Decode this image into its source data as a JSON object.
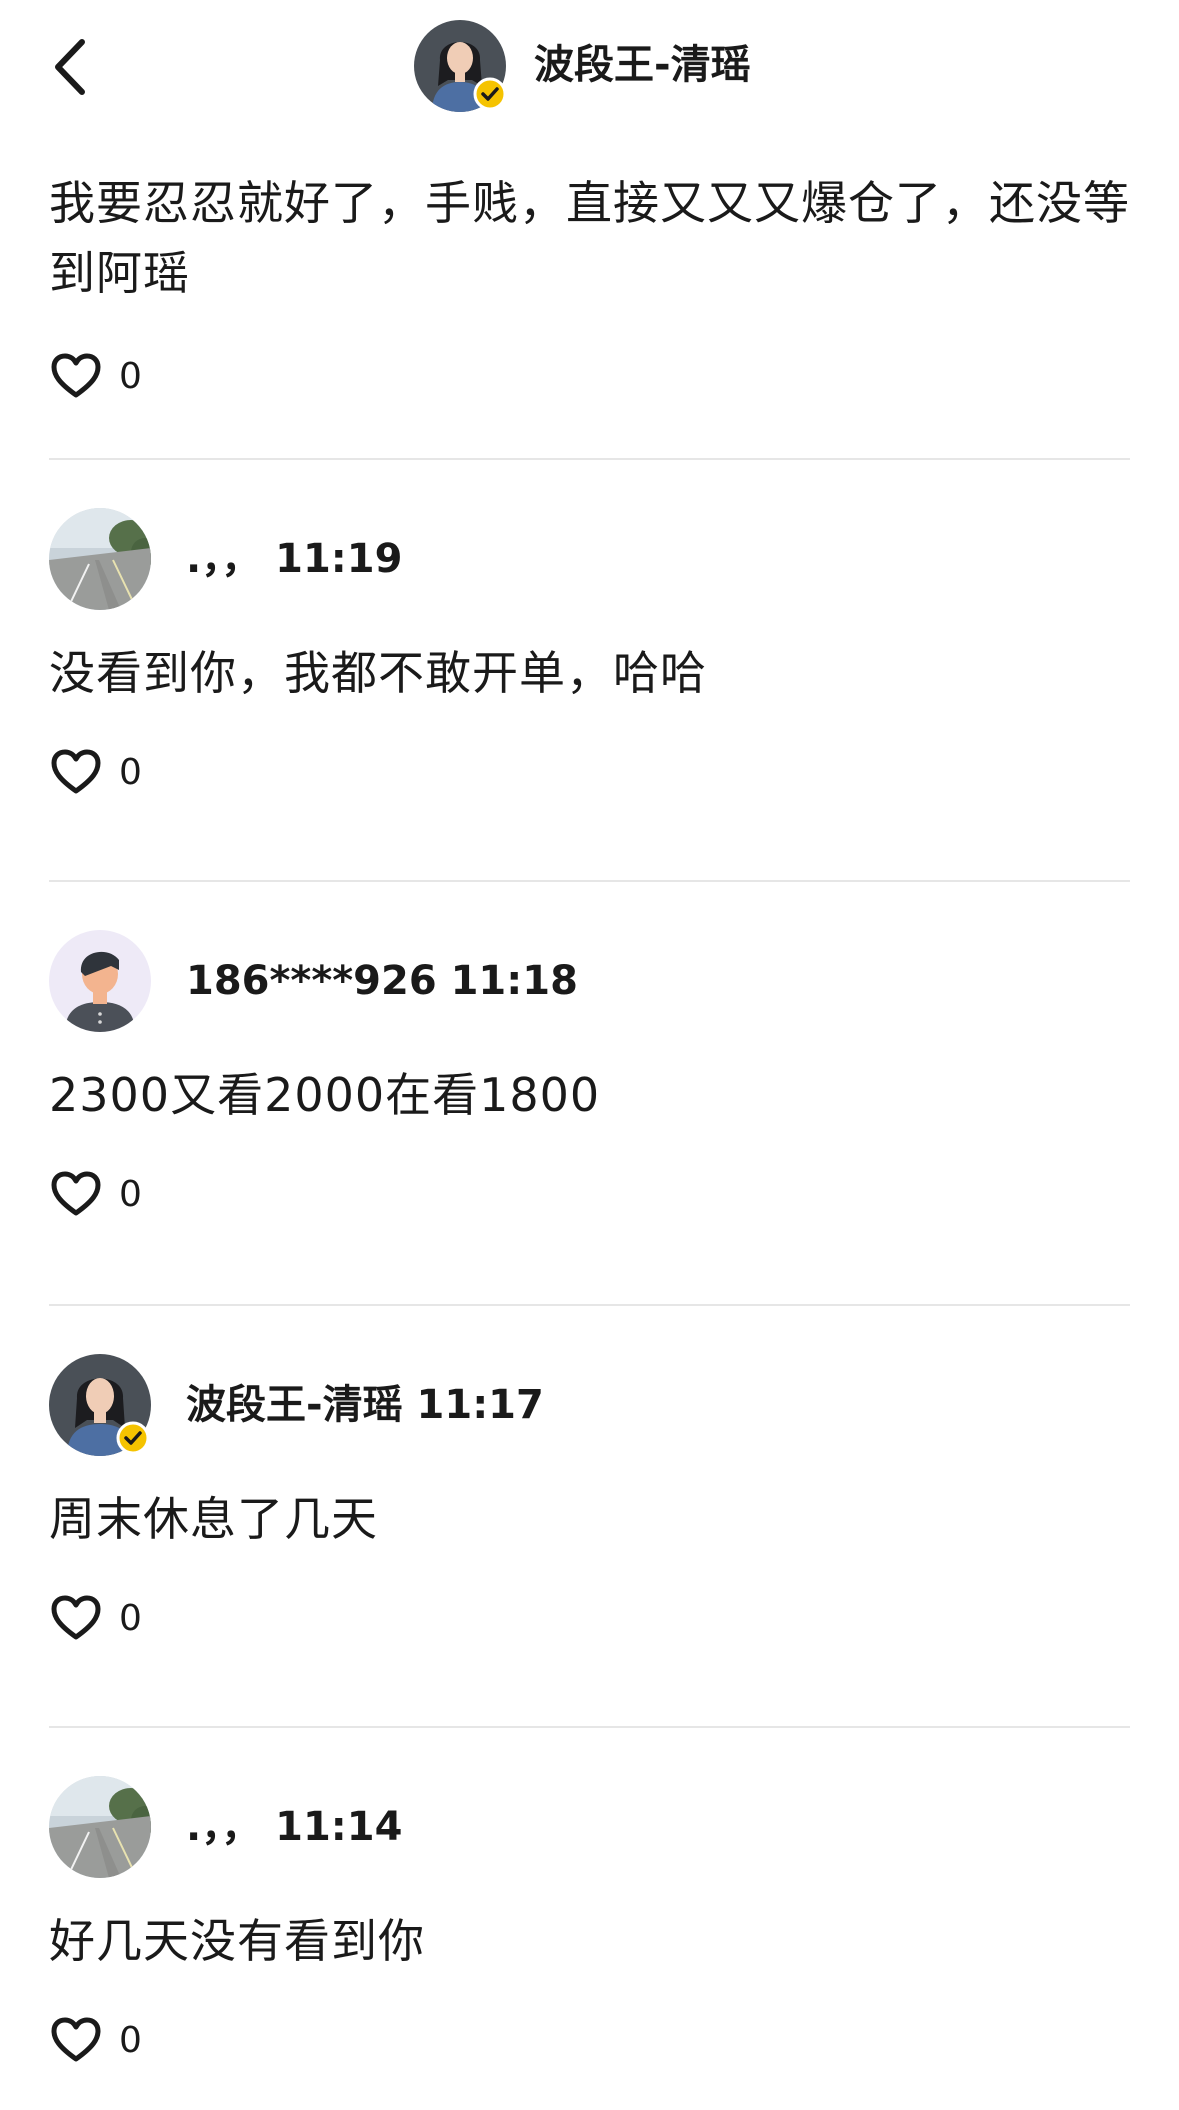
{
  "header": {
    "back_icon": "chevron-left-icon",
    "avatar_icon": "verified-avatar",
    "title": "波段王-清瑶"
  },
  "top_comment": {
    "text": "我要忍忍就好了，手贱，直接又又又爆仓了，还没等到阿瑶",
    "likes": "0"
  },
  "comments": [
    {
      "user_time": ".，，  11:19",
      "text": "没看到你，我都不敢开单，哈哈",
      "likes": "0",
      "avatar": "road-photo-avatar"
    },
    {
      "user_time": "186****926 11:18",
      "text": "2300又看2000在看1800",
      "likes": "0",
      "avatar": "default-user-avatar"
    },
    {
      "user_time": "波段王-清瑶 11:17",
      "text": "周末休息了几天",
      "likes": "0",
      "avatar": "verified-avatar"
    },
    {
      "user_time": ".，，  11:14",
      "text": "好几天没有看到你",
      "likes": "0",
      "avatar": "road-photo-avatar"
    }
  ],
  "colors": {
    "verified_badge": "#F5C300",
    "divider": "#E6E6E6",
    "text": "#1A1A1A"
  }
}
